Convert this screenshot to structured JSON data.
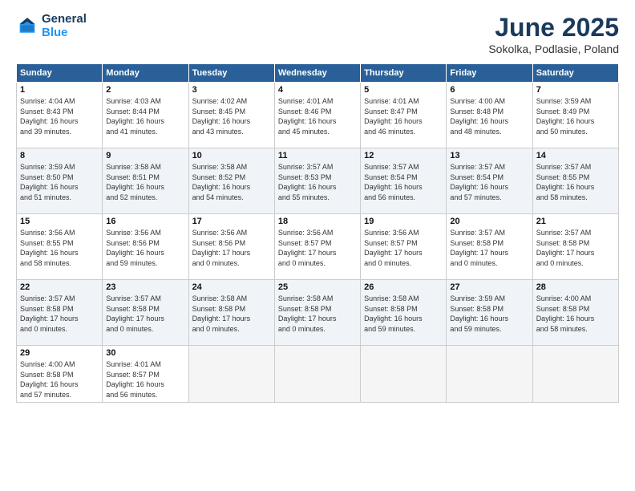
{
  "logo": {
    "line1": "General",
    "line2": "Blue"
  },
  "title": "June 2025",
  "location": "Sokolka, Podlasie, Poland",
  "weekdays": [
    "Sunday",
    "Monday",
    "Tuesday",
    "Wednesday",
    "Thursday",
    "Friday",
    "Saturday"
  ],
  "weeks": [
    [
      {
        "day": "1",
        "info": "Sunrise: 4:04 AM\nSunset: 8:43 PM\nDaylight: 16 hours\nand 39 minutes."
      },
      {
        "day": "2",
        "info": "Sunrise: 4:03 AM\nSunset: 8:44 PM\nDaylight: 16 hours\nand 41 minutes."
      },
      {
        "day": "3",
        "info": "Sunrise: 4:02 AM\nSunset: 8:45 PM\nDaylight: 16 hours\nand 43 minutes."
      },
      {
        "day": "4",
        "info": "Sunrise: 4:01 AM\nSunset: 8:46 PM\nDaylight: 16 hours\nand 45 minutes."
      },
      {
        "day": "5",
        "info": "Sunrise: 4:01 AM\nSunset: 8:47 PM\nDaylight: 16 hours\nand 46 minutes."
      },
      {
        "day": "6",
        "info": "Sunrise: 4:00 AM\nSunset: 8:48 PM\nDaylight: 16 hours\nand 48 minutes."
      },
      {
        "day": "7",
        "info": "Sunrise: 3:59 AM\nSunset: 8:49 PM\nDaylight: 16 hours\nand 50 minutes."
      }
    ],
    [
      {
        "day": "8",
        "info": "Sunrise: 3:59 AM\nSunset: 8:50 PM\nDaylight: 16 hours\nand 51 minutes."
      },
      {
        "day": "9",
        "info": "Sunrise: 3:58 AM\nSunset: 8:51 PM\nDaylight: 16 hours\nand 52 minutes."
      },
      {
        "day": "10",
        "info": "Sunrise: 3:58 AM\nSunset: 8:52 PM\nDaylight: 16 hours\nand 54 minutes."
      },
      {
        "day": "11",
        "info": "Sunrise: 3:57 AM\nSunset: 8:53 PM\nDaylight: 16 hours\nand 55 minutes."
      },
      {
        "day": "12",
        "info": "Sunrise: 3:57 AM\nSunset: 8:54 PM\nDaylight: 16 hours\nand 56 minutes."
      },
      {
        "day": "13",
        "info": "Sunrise: 3:57 AM\nSunset: 8:54 PM\nDaylight: 16 hours\nand 57 minutes."
      },
      {
        "day": "14",
        "info": "Sunrise: 3:57 AM\nSunset: 8:55 PM\nDaylight: 16 hours\nand 58 minutes."
      }
    ],
    [
      {
        "day": "15",
        "info": "Sunrise: 3:56 AM\nSunset: 8:55 PM\nDaylight: 16 hours\nand 58 minutes."
      },
      {
        "day": "16",
        "info": "Sunrise: 3:56 AM\nSunset: 8:56 PM\nDaylight: 16 hours\nand 59 minutes."
      },
      {
        "day": "17",
        "info": "Sunrise: 3:56 AM\nSunset: 8:56 PM\nDaylight: 17 hours\nand 0 minutes."
      },
      {
        "day": "18",
        "info": "Sunrise: 3:56 AM\nSunset: 8:57 PM\nDaylight: 17 hours\nand 0 minutes."
      },
      {
        "day": "19",
        "info": "Sunrise: 3:56 AM\nSunset: 8:57 PM\nDaylight: 17 hours\nand 0 minutes."
      },
      {
        "day": "20",
        "info": "Sunrise: 3:57 AM\nSunset: 8:58 PM\nDaylight: 17 hours\nand 0 minutes."
      },
      {
        "day": "21",
        "info": "Sunrise: 3:57 AM\nSunset: 8:58 PM\nDaylight: 17 hours\nand 0 minutes."
      }
    ],
    [
      {
        "day": "22",
        "info": "Sunrise: 3:57 AM\nSunset: 8:58 PM\nDaylight: 17 hours\nand 0 minutes."
      },
      {
        "day": "23",
        "info": "Sunrise: 3:57 AM\nSunset: 8:58 PM\nDaylight: 17 hours\nand 0 minutes."
      },
      {
        "day": "24",
        "info": "Sunrise: 3:58 AM\nSunset: 8:58 PM\nDaylight: 17 hours\nand 0 minutes."
      },
      {
        "day": "25",
        "info": "Sunrise: 3:58 AM\nSunset: 8:58 PM\nDaylight: 17 hours\nand 0 minutes."
      },
      {
        "day": "26",
        "info": "Sunrise: 3:58 AM\nSunset: 8:58 PM\nDaylight: 16 hours\nand 59 minutes."
      },
      {
        "day": "27",
        "info": "Sunrise: 3:59 AM\nSunset: 8:58 PM\nDaylight: 16 hours\nand 59 minutes."
      },
      {
        "day": "28",
        "info": "Sunrise: 4:00 AM\nSunset: 8:58 PM\nDaylight: 16 hours\nand 58 minutes."
      }
    ],
    [
      {
        "day": "29",
        "info": "Sunrise: 4:00 AM\nSunset: 8:58 PM\nDaylight: 16 hours\nand 57 minutes."
      },
      {
        "day": "30",
        "info": "Sunrise: 4:01 AM\nSunset: 8:57 PM\nDaylight: 16 hours\nand 56 minutes."
      },
      {
        "day": "",
        "info": ""
      },
      {
        "day": "",
        "info": ""
      },
      {
        "day": "",
        "info": ""
      },
      {
        "day": "",
        "info": ""
      },
      {
        "day": "",
        "info": ""
      }
    ]
  ]
}
